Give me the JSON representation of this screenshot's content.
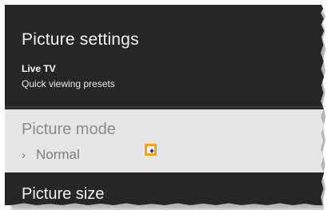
{
  "header": {
    "title": "Picture settings",
    "subtitle": "Live TV",
    "description": "Quick viewing presets"
  },
  "menu": {
    "items": [
      {
        "label": "Picture mode",
        "value": "Normal",
        "expand_icon": "chevron-right-icon",
        "focus_icon": "diamond-icon",
        "selected": true
      },
      {
        "label": "Picture size",
        "selected": false
      }
    ]
  },
  "colors": {
    "panel_background": "#262626",
    "selected_row_background": "#e6e6e6",
    "focus_outline": "#f2a31a",
    "focus_marker": "#6a2d8c"
  }
}
